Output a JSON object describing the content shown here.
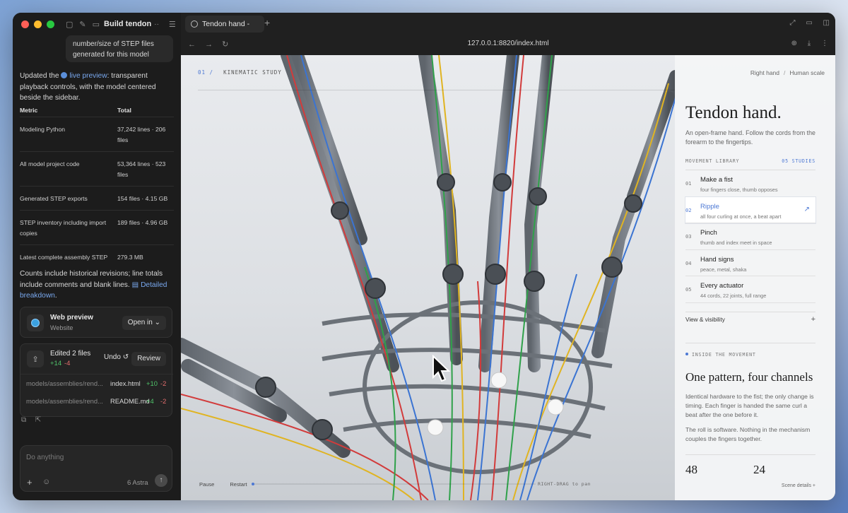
{
  "sidebar": {
    "title": "Build tendon",
    "title_dots": "··",
    "user_message": "number/size of STEP files generated for this model",
    "updated_prefix": "Updated the ",
    "live_preview_link": "live preview",
    "updated_suffix": ": transparent playback controls, with the model centered beside the sidebar.",
    "table": {
      "headers": [
        "Metric",
        "Total"
      ],
      "rows": [
        {
          "metric": "Modeling Python",
          "total": "37,242 lines · 206 files"
        },
        {
          "metric": "All model project code",
          "total": "53,364 lines · 523 files"
        },
        {
          "metric": "Generated STEP exports",
          "total": "154 files · 4.15 GB"
        },
        {
          "metric": "STEP inventory including import copies",
          "total": "189 files · 4.96 GB"
        },
        {
          "metric": "Latest complete assembly STEP",
          "total": "279.3 MB"
        }
      ]
    },
    "counts_text": "Counts include historical revisions; line totals include comments and blank lines.",
    "breakdown_link": "Detailed breakdown",
    "counts_end": ".",
    "web_preview": {
      "title": "Web preview",
      "subtitle": "Website",
      "open_in": "Open in"
    },
    "edited": {
      "title": "Edited 2 files",
      "plus": "+14",
      "minus": "-4",
      "undo": "Undo",
      "review": "Review",
      "files": [
        {
          "path": "models/assemblies/rend...",
          "name": "index.html",
          "plus": "+10",
          "minus": "-2"
        },
        {
          "path": "models/assemblies/rend...",
          "name": "README.md",
          "plus": "+4",
          "minus": "-2"
        }
      ]
    },
    "composer": {
      "placeholder": "Do anything",
      "model": "6 Astra"
    }
  },
  "browser": {
    "tab_title": "Tendon hand -",
    "url": "127.0.0.1:8820/index.html"
  },
  "page": {
    "section_num": "01 /",
    "section_label": "KINEMATIC STUDY",
    "crumb_left": "Right hand",
    "crumb_sep": "/",
    "crumb_right": "Human scale",
    "title": "Tendon hand.",
    "intro": "An open-frame hand. Follow the cords from the forearm to the fingertips.",
    "library_label": "MOVEMENT LIBRARY",
    "library_count": "05 STUDIES",
    "movements": [
      {
        "num": "01",
        "title": "Make a fist",
        "sub": "four fingers close, thumb opposes"
      },
      {
        "num": "02",
        "title": "Ripple",
        "sub": "all four curling at once, a beat apart"
      },
      {
        "num": "03",
        "title": "Pinch",
        "sub": "thumb and index meet in space"
      },
      {
        "num": "04",
        "title": "Hand signs",
        "sub": "peace, metal, shaka"
      },
      {
        "num": "05",
        "title": "Every actuator",
        "sub": "44 cords, 22 joints, full range"
      }
    ],
    "view_visibility": "View & visibility",
    "inside_label": "INSIDE THE MOVEMENT",
    "inside_title": "One pattern, four channels",
    "para1": "Identical hardware to the fist; the only change is timing. Each finger is handed the same curl a beat after the one before it.",
    "para2": "The roll is software. Nothing in the mechanism couples the fingers together.",
    "stat1": "48",
    "stat2": "24",
    "pause": "Pause",
    "restart": "Restart",
    "hint": "RIGHT-DRAG to pan",
    "scene_details": "Scene details"
  },
  "colors": {
    "accent": "#4c78d4",
    "plus": "#4fc36a",
    "minus": "#e36d6d"
  }
}
